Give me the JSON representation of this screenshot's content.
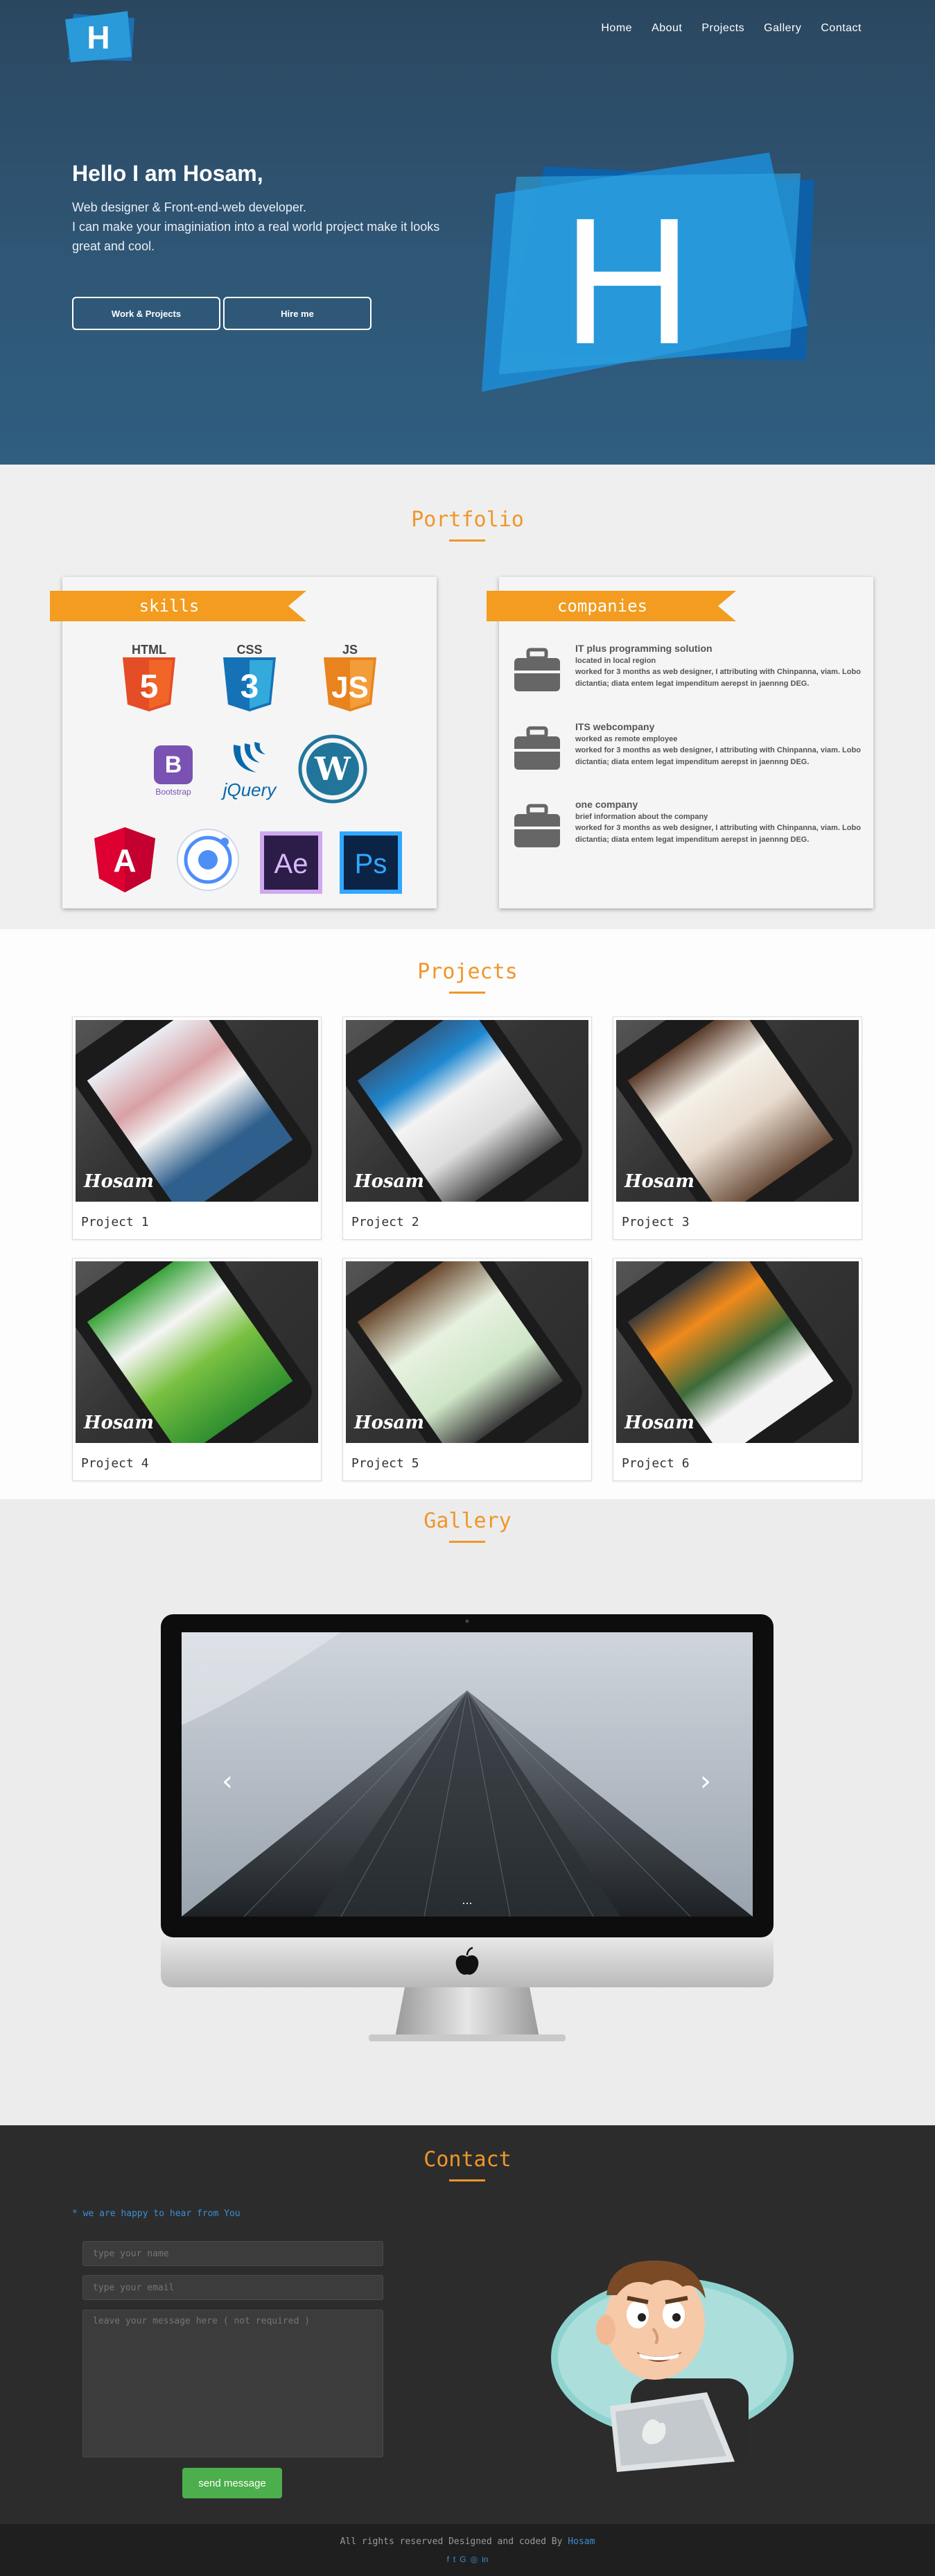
{
  "nav": {
    "items": [
      "Home",
      "About",
      "Projects",
      "Gallery",
      "Contact"
    ]
  },
  "brand": {
    "logo_letter": "H",
    "accent": "#1f8fd6"
  },
  "hero": {
    "title": "Hello I am Hosam,",
    "line1": "Web designer & Front-end-web developer.",
    "line2": "I can make your imaginiation into a real world project make it looks great and cool.",
    "btn_work": "Work & Projects",
    "btn_hire": "Hire me"
  },
  "portfolio": {
    "title": "Portfolio",
    "skills_title": "skills",
    "skills": [
      "HTML",
      "CSS",
      "JS",
      "Bootstrap",
      "jQuery",
      "WordPress",
      "Angular",
      "Ionic",
      "Ae",
      "Ps"
    ],
    "companies_title": "companies",
    "companies": [
      {
        "name": "IT plus programming solution",
        "role": "located in local region",
        "desc": "worked for 3 months as web designer, I attributing with Chinpanna, viam. Lobo dictantia; diata entem legat impenditum aerepst in jaennng DEG."
      },
      {
        "name": "ITS webcompany",
        "role": "worked as remote employee",
        "desc": "worked for 3 months as web designer, I attributing with Chinpanna, viam. Lobo dictantia; diata entem legat impenditum aerepst in jaennng DEG."
      },
      {
        "name": "one company",
        "role": "brief information about the company",
        "desc": "worked for 3 months as web designer, I attributing with Chinpanna, viam. Lobo dictantia; diata entem legat impenditum aerepst in jaennng DEG."
      }
    ]
  },
  "projects": {
    "title": "Projects",
    "signature": "Hosam",
    "items": [
      "Project 1",
      "Project 2",
      "Project 3",
      "Project 4",
      "Project 5",
      "Project 6"
    ]
  },
  "gallery": {
    "title": "Gallery",
    "prev": "‹",
    "next": "›",
    "dots": "..."
  },
  "contact": {
    "title": "Contact",
    "happy": "* we are happy to hear from You",
    "name_ph": "type your name",
    "email_ph": "type your email",
    "msg_ph": "leave your message here ( not required )",
    "send": "send message"
  },
  "footer": {
    "copy": "All rights reserved Designed and coded By",
    "author": "Hosam",
    "social": [
      "f",
      "t",
      "G",
      "◎",
      "in"
    ]
  }
}
